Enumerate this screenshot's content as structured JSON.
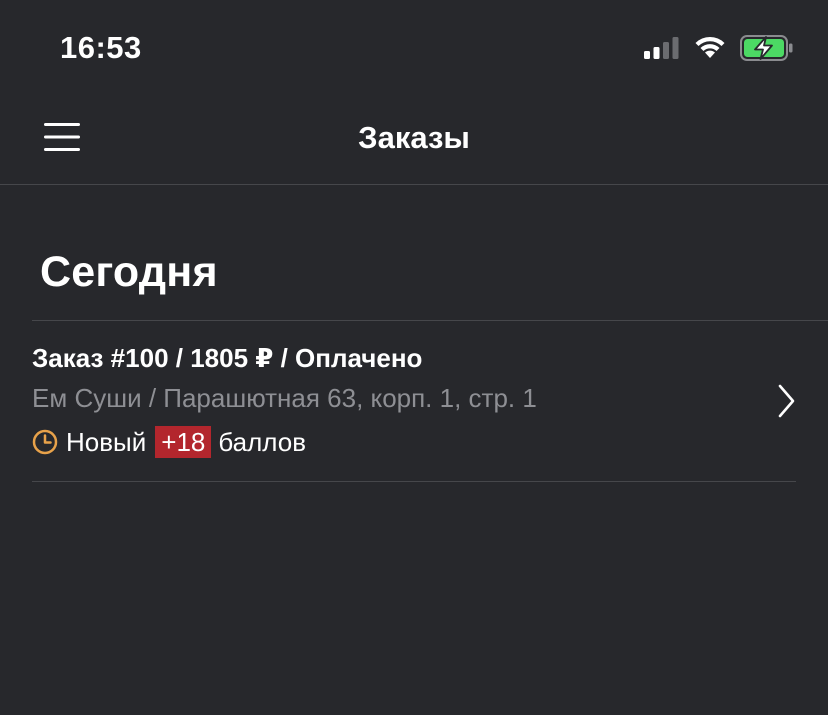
{
  "status_bar": {
    "time": "16:53",
    "icons": [
      "signal-icon",
      "wifi-icon",
      "battery-charging-icon"
    ],
    "battery_color": "#4cd964"
  },
  "nav": {
    "title": "Заказы",
    "menu_icon": "hamburger-menu-icon"
  },
  "section": {
    "title": "Сегодня"
  },
  "orders": [
    {
      "title": "Заказ #100 / 1805 ₽ / Оплачено",
      "address": "Ем Суши / Парашютная 63, корп. 1, стр. 1",
      "status_icon": "clock-icon",
      "status": "Новый",
      "points": "+18",
      "points_label": "баллов"
    }
  ],
  "colors": {
    "background": "#27282c",
    "accent_clock": "#e8a24a",
    "points_badge": "#b3262d",
    "secondary_text": "#8e8f94"
  }
}
